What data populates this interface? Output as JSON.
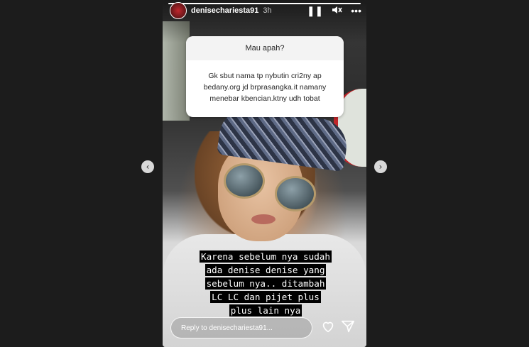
{
  "story": {
    "username": "denisechariesta91",
    "time_ago": "3h",
    "progress": 1.0,
    "controls": {
      "pause_icon": "pause-icon",
      "mute_icon": "speaker-muted-icon",
      "more_icon": "more-icon"
    },
    "pause_glyph": "❚❚",
    "mute_glyph": "🔇",
    "more_glyph": "•••"
  },
  "question_card": {
    "prompt": "Mau apah?",
    "answer_lines": [
      "Gk sbut nama tp nybutin cri2ny ap",
      "bedany.org jd brprasangka.it namany",
      "menebar kbencian.ktny udh tobat"
    ]
  },
  "caption_lines": [
    "Karena sebelum nya sudah",
    "ada denise denise yang",
    "sebelum nya.. ditambah",
    "LC LC dan pijet plus",
    "plus lain nya"
  ],
  "reply": {
    "placeholder": "Reply to denisechariesta91...",
    "like_icon": "heart-icon",
    "send_icon": "send-icon"
  },
  "navigation": {
    "prev_glyph": "‹",
    "next_glyph": "›"
  },
  "colors": {
    "background": "#1c1c1c",
    "caption_bg": "#000000",
    "card_bg": "#ffffff",
    "accent_red": "#c0262a"
  }
}
